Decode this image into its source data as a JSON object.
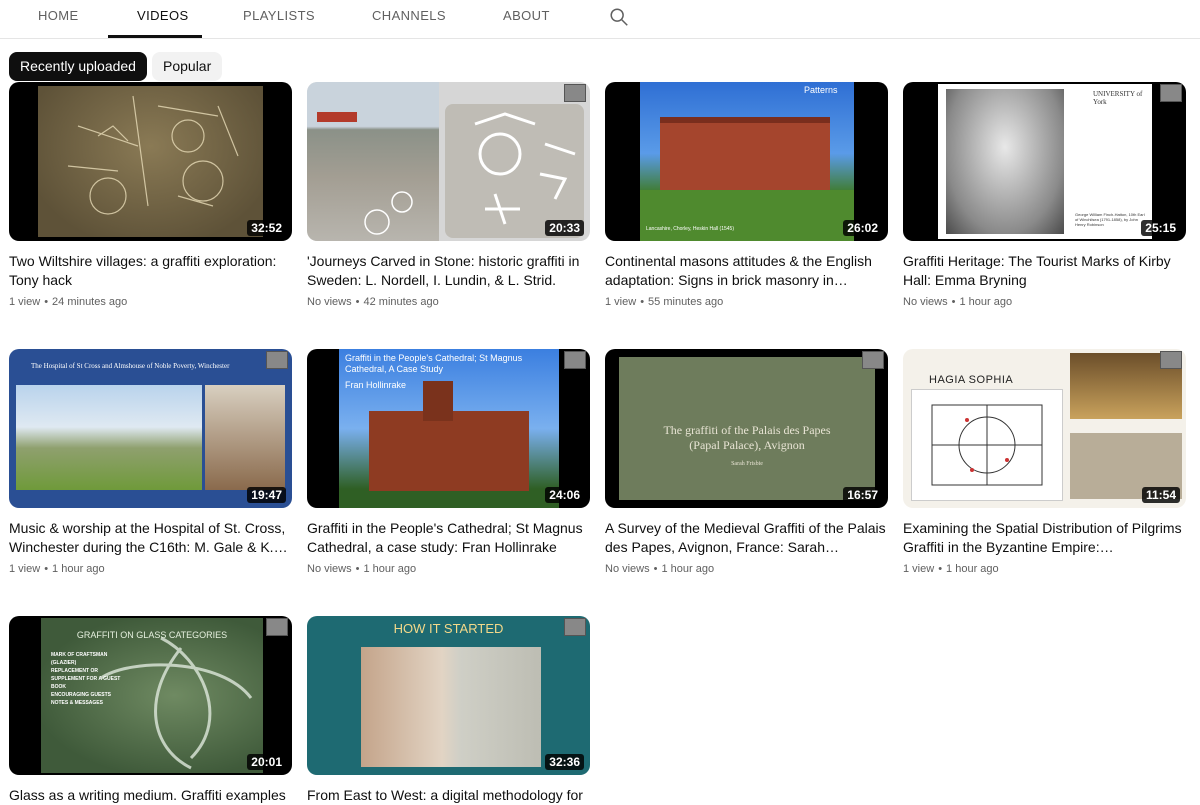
{
  "nav": {
    "tabs": [
      "HOME",
      "VIDEOS",
      "PLAYLISTS",
      "CHANNELS",
      "ABOUT"
    ],
    "active_tab": "VIDEOS"
  },
  "filters": {
    "recent": "Recently uploaded",
    "popular": "Popular"
  },
  "videos": [
    {
      "title": "Two Wiltshire villages: a graffiti exploration: Tony hack",
      "views": "1 view",
      "age": "24 minutes ago",
      "duration": "32:52"
    },
    {
      "title": "'Journeys Carved in Stone: historic graffiti in Sweden: L. Nordell, I. Lundin, & L. Strid.",
      "views": "No views",
      "age": "42 minutes ago",
      "duration": "20:33"
    },
    {
      "title": "Continental masons attitudes & the English adaptation: Signs in brick masonry in…",
      "views": "1 view",
      "age": "55 minutes ago",
      "duration": "26:02",
      "thumb_label": "Patterns",
      "thumb_caption": "Lancashire, Chorley, Heskin Hall (1545)"
    },
    {
      "title": "Graffiti Heritage: The Tourist Marks of Kirby Hall: Emma Bryning",
      "views": "No views",
      "age": "1 hour ago",
      "duration": "25:15",
      "thumb_logo": "UNIVERSITY of York",
      "thumb_caption": "George William Finch-Hatton, 10th Earl of Winchilsea (1791-1858), by John Henry Robinson"
    },
    {
      "title": "Music & worship at the Hospital of St. Cross, Winchester during the C16th: M. Gale & K.…",
      "views": "1 view",
      "age": "1 hour ago",
      "duration": "19:47",
      "thumb_heading": "The Hospital of St Cross and Almshouse of Noble Poverty, Winchester"
    },
    {
      "title": "Graffiti in the People's Cathedral; St Magnus Cathedral, a case study: Fran Hollinrake",
      "views": "No views",
      "age": "1 hour ago",
      "duration": "24:06",
      "thumb_heading": "Graffiti in the People's Cathedral; St Magnus Cathedral, A Case Study",
      "thumb_author": "Fran Hollinrake"
    },
    {
      "title": "A Survey of the Medieval Graffiti of the Palais des Papes, Avignon, France: Sarah…",
      "views": "No views",
      "age": "1 hour ago",
      "duration": "16:57",
      "thumb_heading": "The graffiti of the Palais des Papes (Papal Palace), Avignon",
      "thumb_author": "Sarah Frisbie"
    },
    {
      "title": "Examining the Spatial Distribution of Pilgrims Graffiti in the Byzantine Empire:…",
      "views": "1 view",
      "age": "1 hour ago",
      "duration": "11:54",
      "thumb_heading": "HAGIA SOPHIA"
    },
    {
      "title": "Glass as a writing medium. Graffiti examples",
      "duration": "20:01",
      "thumb_heading": "GRAFFITI ON GLASS CATEGORIES",
      "thumb_list": [
        "MARK OF CRAFTSMAN (GLAZIER)",
        "REPLACEMENT OR SUPPLEMENT FOR A GUEST BOOK",
        "ENCOURAGING GUESTS",
        "NOTES & MESSAGES"
      ]
    },
    {
      "title": "From East to West: a digital methodology for",
      "duration": "32:36",
      "thumb_heading": "HOW IT STARTED"
    }
  ]
}
